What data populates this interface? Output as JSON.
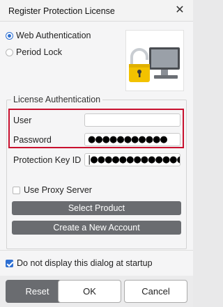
{
  "window": {
    "title": "Register Protection License",
    "close_glyph": "✕"
  },
  "mode": {
    "options": [
      "Web Authentication",
      "Period Lock"
    ],
    "selected": "Web Authentication"
  },
  "illustration": {
    "icon": "computer-with-padlock-icon",
    "colors": {
      "lock": "#f2c200",
      "lock_shackle": "#c9cdd2",
      "monitor": "#4a4d52"
    }
  },
  "license": {
    "legend": "License Authentication",
    "user_label": "User",
    "user_value": "",
    "password_label": "Password",
    "password_value": "●●●●●●●●●●●",
    "key_label": "Protection Key ID",
    "key_value": "|●●●●●●●●●●●●●●●●●●",
    "highlight_color": "#c8102e"
  },
  "proxy": {
    "label": "Use Proxy Server",
    "checked": false
  },
  "buttons": {
    "select_product": "Select Product",
    "create_account": "Create a New Account",
    "reset": "Reset",
    "ok": "OK",
    "cancel": "Cancel"
  },
  "startup": {
    "label": "Do not display this dialog at startup",
    "checked": true
  },
  "colors": {
    "accent": "#2d6fd2",
    "dark_button": "#6a6c70"
  }
}
